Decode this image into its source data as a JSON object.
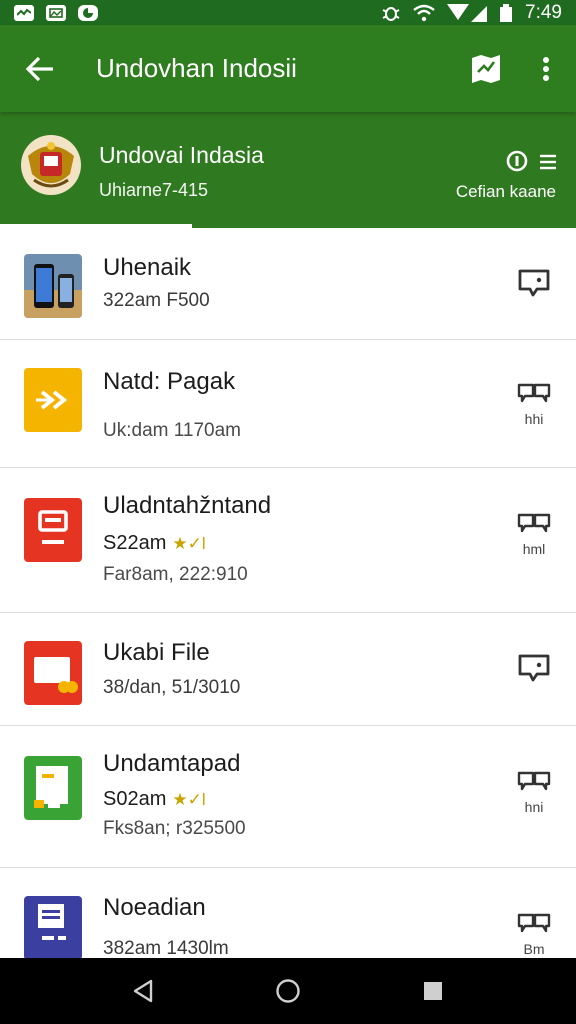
{
  "status_bar": {
    "time": "7:49",
    "left_icons": [
      "activity-icon",
      "image-icon",
      "app-icon"
    ],
    "right_icons": [
      "bug-icon",
      "wifi-icon",
      "signal-icon",
      "battery-icon"
    ]
  },
  "app_bar": {
    "title": "Undovhan Indosii"
  },
  "header": {
    "title": "Undovai Indasia",
    "subtitle": "Uhiarne7-415",
    "right_text": "Cefian kaane"
  },
  "items": [
    {
      "title": "Uhenaik",
      "line1": "322am F500",
      "line2": "",
      "stars": "",
      "action_label": "",
      "icon": "phones-photo"
    },
    {
      "title": "Natd: Pagak",
      "line1": "",
      "line2": "Uk:dam 1170am",
      "stars": "",
      "action_label": "hhi",
      "icon": "arrow-icon"
    },
    {
      "title": "Uladntahžntand",
      "line1": "S22am",
      "line2": "Far8am, 222:910",
      "stars": "★✓l",
      "action_label": "hml",
      "icon": "document-icon"
    },
    {
      "title": "Ukabi File",
      "line1": "38/dan, 51/3010",
      "line2": "",
      "stars": "",
      "action_label": "",
      "icon": "file-icon"
    },
    {
      "title": "Undamtapad",
      "line1": "S02am",
      "line2": "Fks8an; r325500",
      "stars": "★✓l",
      "action_label": "hni",
      "icon": "sheet-icon"
    },
    {
      "title": "Noeadian",
      "line1": "382am 1430lm",
      "line2": "",
      "stars": "",
      "action_label": "Bm",
      "icon": "doc-blue-icon"
    }
  ],
  "colors": {
    "primary": "#2e7d1f",
    "status": "#1f6b1f",
    "yellow_icon": "#f4b400",
    "red_icon": "#e53522",
    "green_icon": "#3aa336",
    "blue_icon": "#3b3fa0"
  }
}
